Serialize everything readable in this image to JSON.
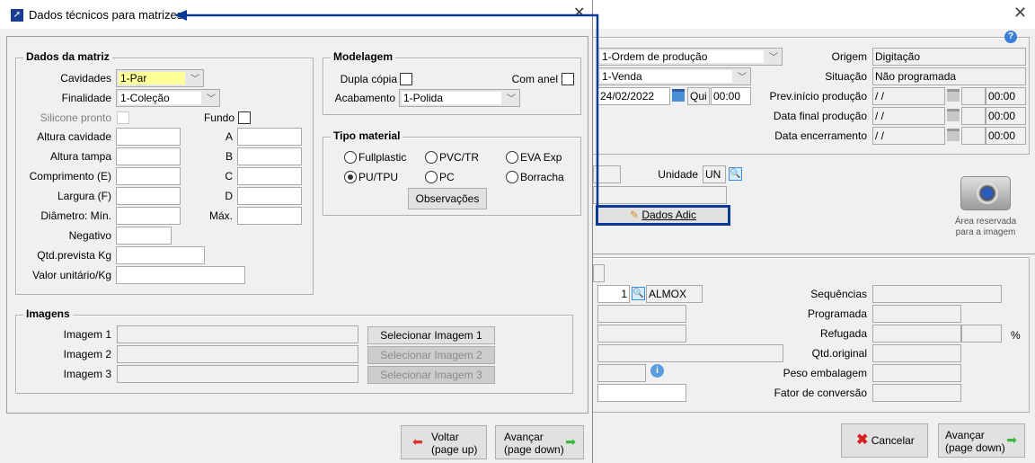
{
  "background": {
    "tipo": "1-Ordem de produção",
    "finalidade": "1-Venda",
    "data": "24/02/2022",
    "dia": "Qui",
    "hora": "00:00",
    "origem_label": "Origem",
    "origem": "Digitação",
    "situacao_label": "Situação",
    "situacao": "Não programada",
    "prev_label": "Prev.início produção",
    "final_label": "Data final produção",
    "enc_label": "Data encerramento",
    "date_empty": " /  /",
    "time_empty": "00:00",
    "unidade_label": "Unidade",
    "unidade": "UN",
    "dados_adic": "Dados Adic",
    "image_area": "Área reservada",
    "image_area2": "para a imagem",
    "qty": "1",
    "almox": "ALMOX",
    "sequencias": "Sequências",
    "programada": "Programada",
    "refugada": "Refugada",
    "percent": "%",
    "qtd_original": "Qtd.original",
    "peso_embalagem": "Peso embalagem",
    "fator": "Fator de conversão",
    "cancel": "Cancelar",
    "next1": "Avançar",
    "next2": "(page down)"
  },
  "dialog": {
    "title": "Dados técnicos para matrizes",
    "dados_matriz": "Dados da matriz",
    "cavidades_label": "Cavidades",
    "cavidades": "1-Par",
    "finalidade_label": "Finalidade",
    "finalidade": "1-Coleção",
    "silicone": "Silicone pronto",
    "fundo": "Fundo",
    "rows": [
      {
        "l": "Altura cavidade",
        "r": "A"
      },
      {
        "l": "Altura tampa",
        "r": "B"
      },
      {
        "l": "Comprimento (E)",
        "r": "C"
      },
      {
        "l": "Largura (F)",
        "r": "D"
      },
      {
        "l": "Diâmetro: Mín.",
        "r": "Máx."
      }
    ],
    "negativo": "Negativo",
    "qtd_prevista": "Qtd.prevista Kg",
    "valor_unitario": "Valor unitário/Kg",
    "modelagem": "Modelagem",
    "dupla": "Dupla cópia",
    "com_anel": "Com anel",
    "acabamento_label": "Acabamento",
    "acabamento": "1-Polida",
    "tipo_material": "Tipo material",
    "materials": [
      "Fullplastic",
      "PVC/TR",
      "EVA Exp",
      "PU/TPU",
      "PC",
      "Borracha"
    ],
    "selected_material": "PU/TPU",
    "observacoes": "Observações",
    "imagens": "Imagens",
    "images": [
      {
        "label": "Imagem 1",
        "btn": "Selecionar Imagem 1"
      },
      {
        "label": "Imagem 2",
        "btn": "Selecionar Imagem 2"
      },
      {
        "label": "Imagem 3",
        "btn": "Selecionar Imagem 3"
      }
    ],
    "back1": "Voltar",
    "back2": "(page up)",
    "next1": "Avançar",
    "next2": "(page down)"
  },
  "colors": {
    "accent": "#0b3a96",
    "highlight": "#ffff99"
  }
}
